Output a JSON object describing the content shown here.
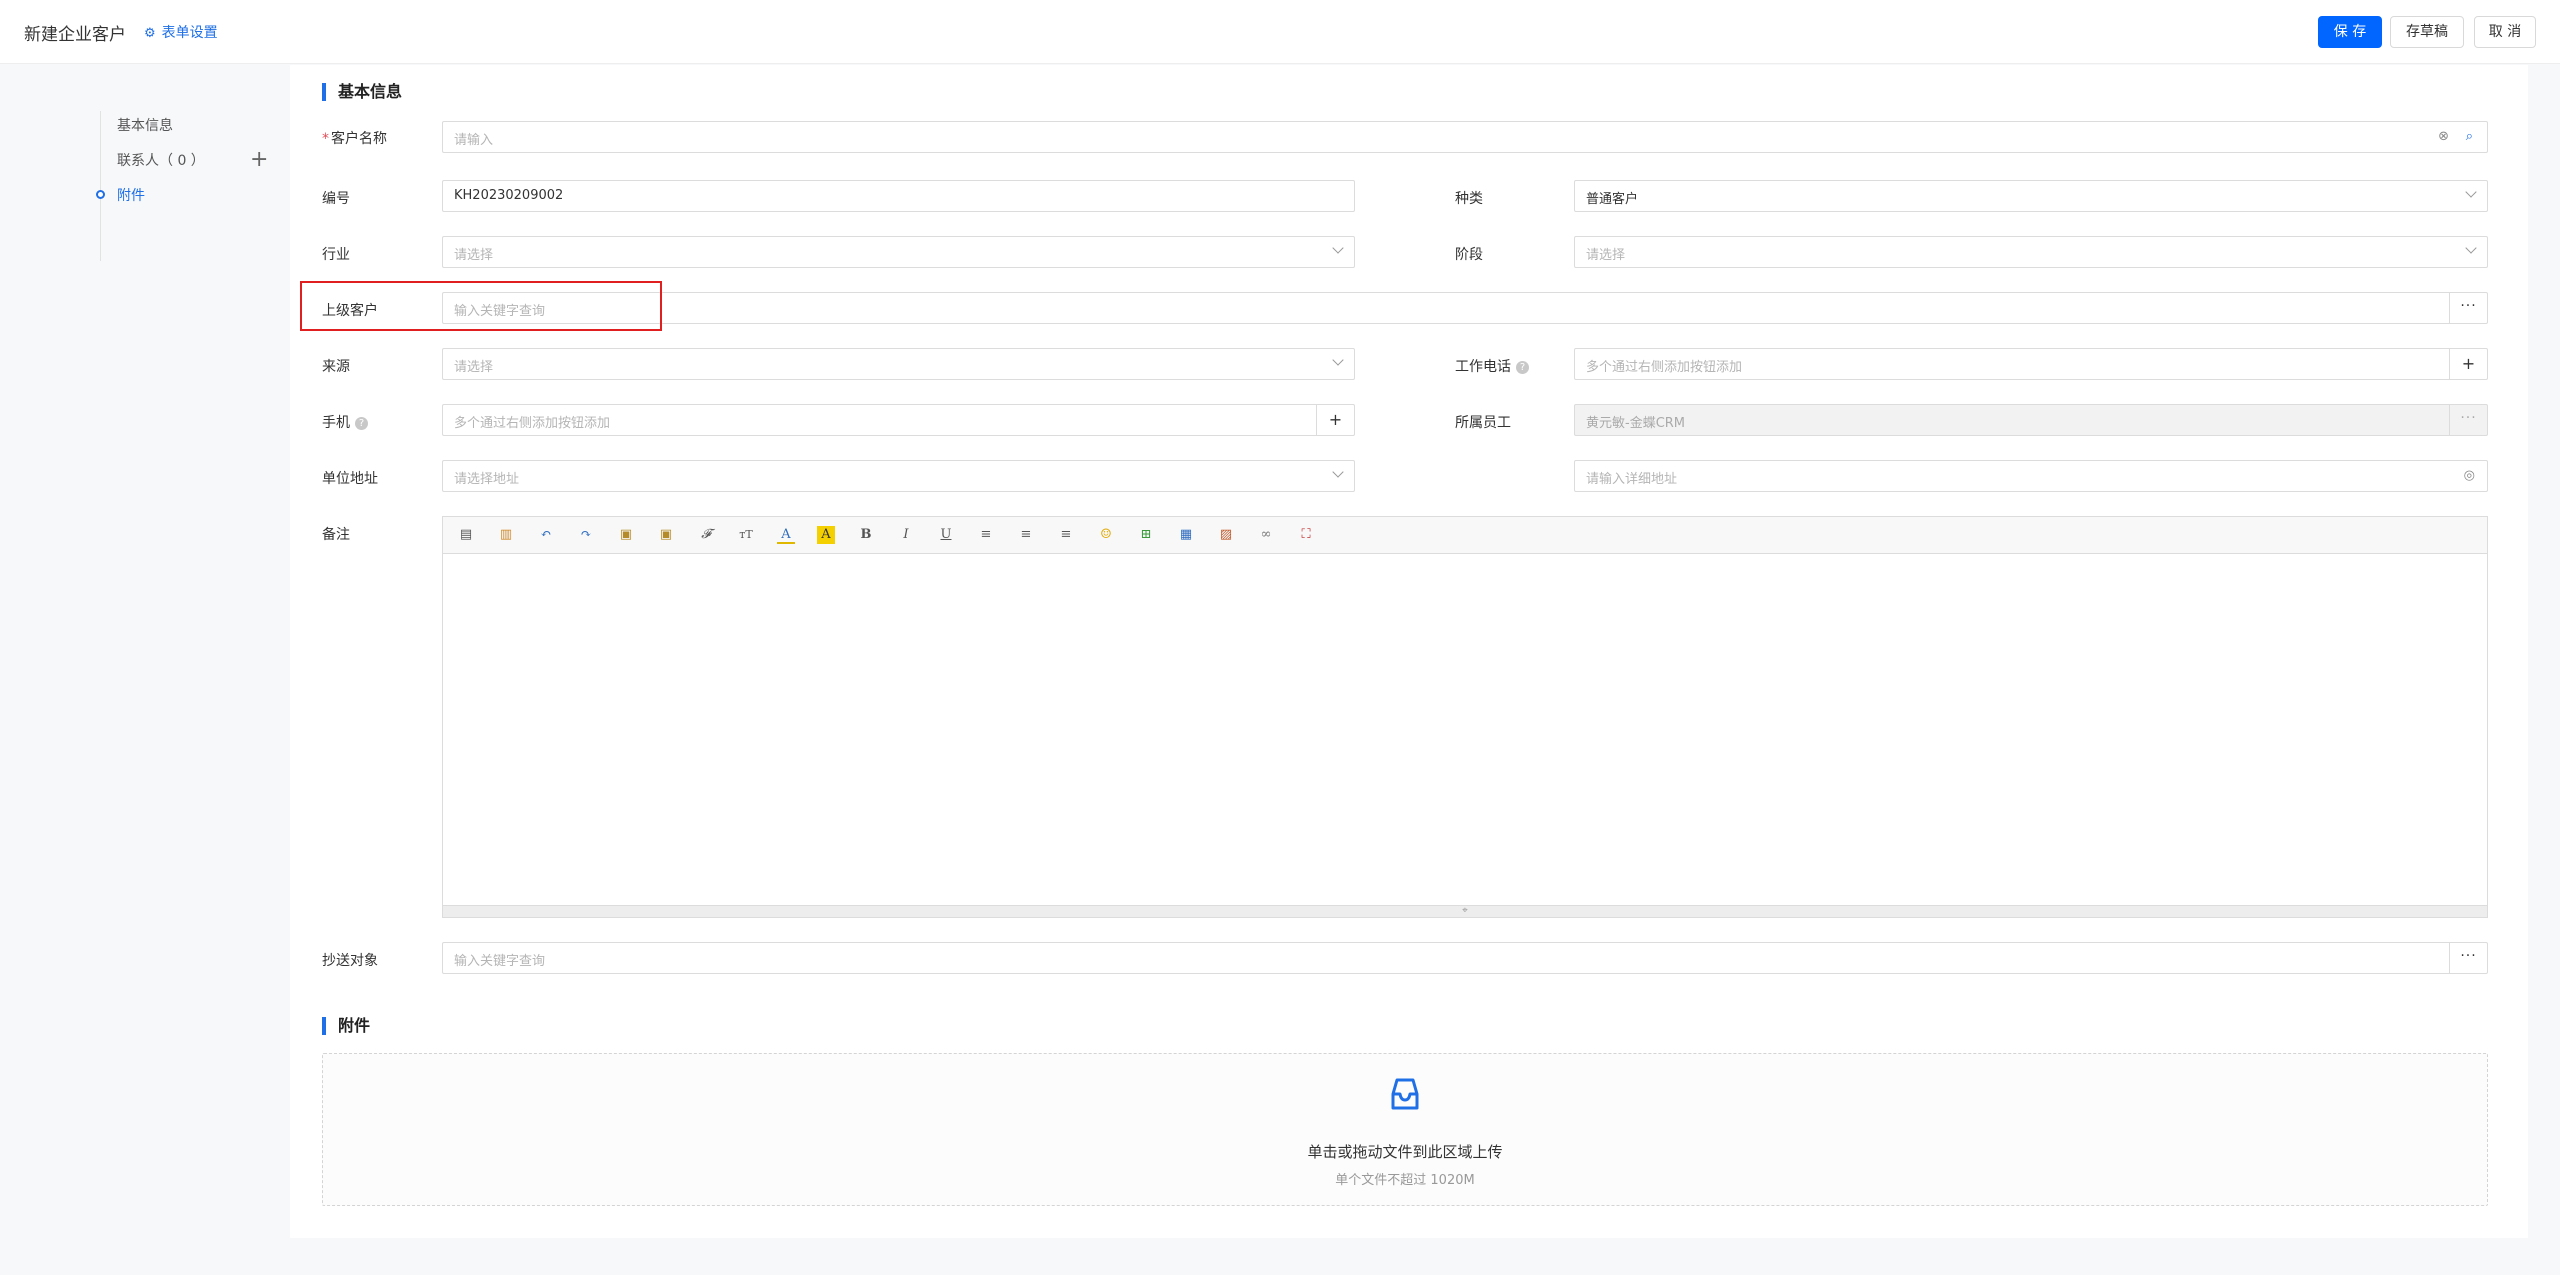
{
  "header": {
    "title": "新建企业客户",
    "form_settings": "表单设置",
    "save": "保 存",
    "draft": "存草稿",
    "cancel": "取 消"
  },
  "nav": {
    "items": [
      "基本信息",
      "联系人（ 0 ）",
      "附件"
    ],
    "active": "附件"
  },
  "sections": {
    "basic": "基本信息",
    "attachments": "附件"
  },
  "form": {
    "customer_name": {
      "label": "客户名称",
      "required_mark": "*",
      "placeholder": "请输入"
    },
    "number": {
      "label": "编号",
      "value": "KH20230209002"
    },
    "category": {
      "label": "种类",
      "value": "普通客户"
    },
    "industry": {
      "label": "行业",
      "placeholder": "请选择"
    },
    "stage": {
      "label": "阶段",
      "placeholder": "请选择"
    },
    "parent_customer": {
      "label": "上级客户",
      "placeholder": "输入关键字查询"
    },
    "source": {
      "label": "来源",
      "placeholder": "请选择"
    },
    "work_phone": {
      "label": "工作电话",
      "placeholder": "多个通过右侧添加按钮添加"
    },
    "mobile": {
      "label": "手机",
      "placeholder": "多个通过右侧添加按钮添加"
    },
    "employee": {
      "label": "所属员工",
      "value": "黄元敏-金蝶CRM"
    },
    "address": {
      "label": "单位地址",
      "placeholder": "请选择地址",
      "detail_placeholder": "请输入详细地址"
    },
    "remark": {
      "label": "备注"
    },
    "cc": {
      "label": "抄送对象",
      "placeholder": "输入关键字查询"
    }
  },
  "upload": {
    "title": "单击或拖动文件到此区域上传",
    "hint": "单个文件不超过 1020M"
  },
  "colors": {
    "accent": "#1f6fe6",
    "primary_button": "#0066ff",
    "highlight": "#e02020",
    "required": "#e34d59"
  }
}
